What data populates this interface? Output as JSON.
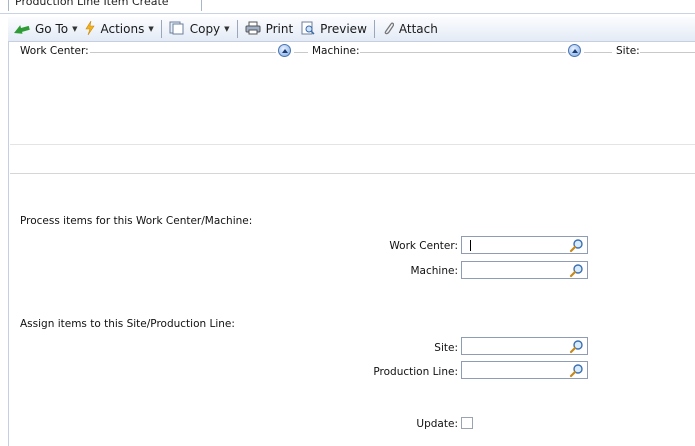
{
  "tab": {
    "title": "Production Line Item Create"
  },
  "toolbar": {
    "goto_label": "Go To",
    "actions_label": "Actions",
    "copy_label": "Copy",
    "print_label": "Print",
    "preview_label": "Preview",
    "attach_label": "Attach"
  },
  "groups": {
    "work_center": "Work Center:",
    "machine": "Machine:",
    "site": "Site:"
  },
  "process_section": {
    "heading": "Process items for this Work Center/Machine:",
    "work_center_label": "Work Center:",
    "work_center_value": "",
    "machine_label": "Machine:",
    "machine_value": ""
  },
  "assign_section": {
    "heading": "Assign items to this Site/Production Line:",
    "site_label": "Site:",
    "site_value": "",
    "production_line_label": "Production Line:",
    "production_line_value": ""
  },
  "update": {
    "label": "Update:",
    "checked": false
  },
  "colors": {
    "accent": "#4a74b3",
    "toolbar_bg": "#e4ebf6",
    "border": "#8e9cb4"
  }
}
